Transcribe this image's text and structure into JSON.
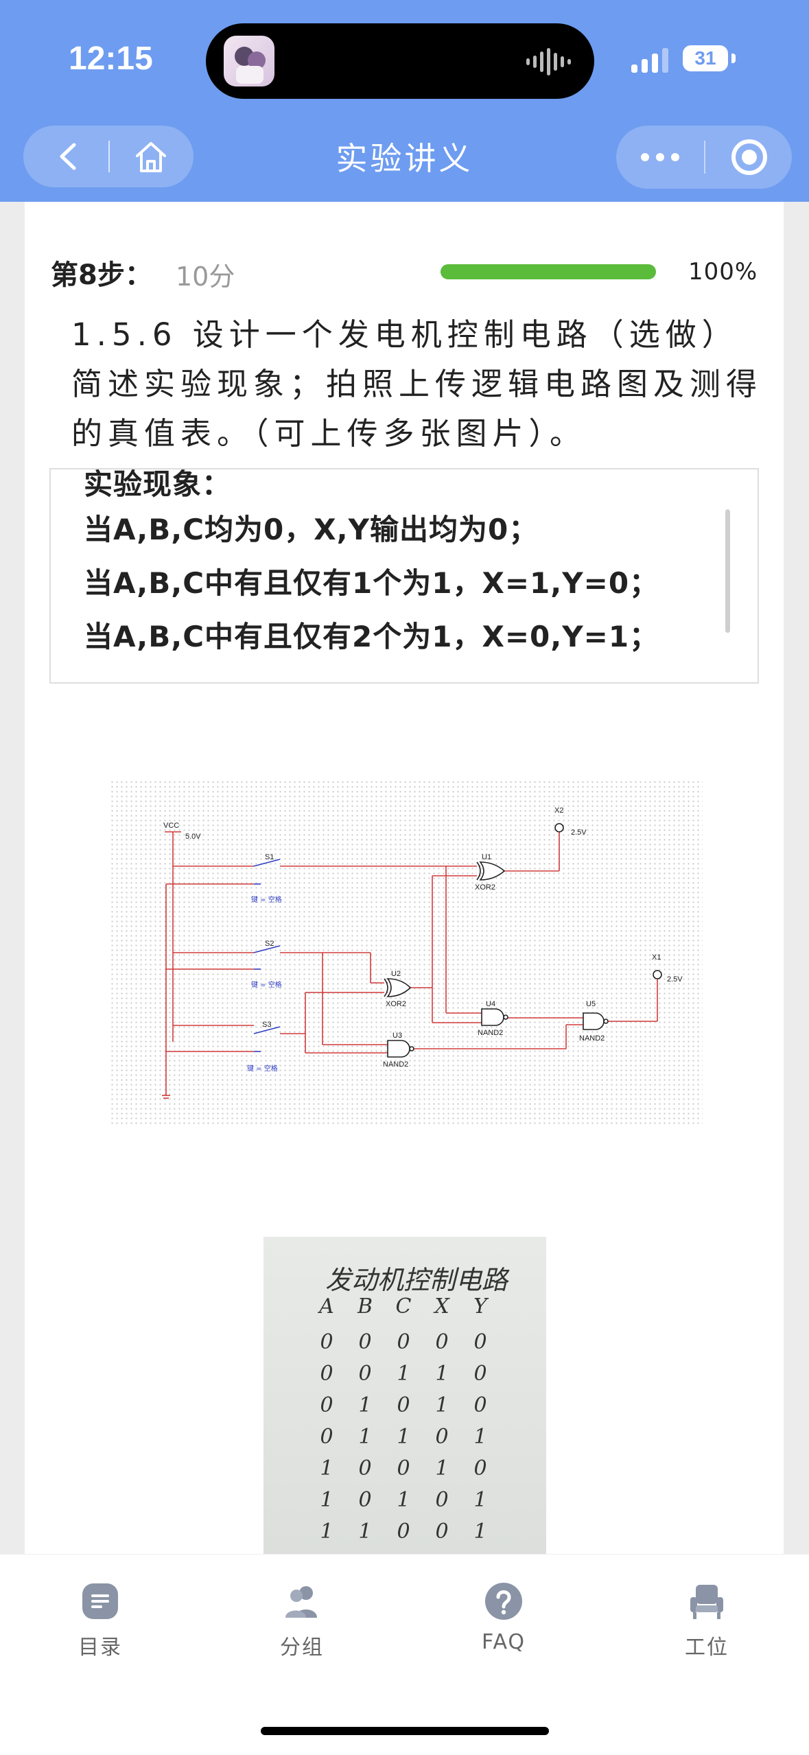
{
  "status_bar": {
    "time": "12:15",
    "battery": "31"
  },
  "nav": {
    "title": "实验讲义"
  },
  "step": {
    "label": "第8步：",
    "score": "10分",
    "progress_text": "100%",
    "progress": 1.0
  },
  "question": {
    "text": "1.5.6 设计一个发电机控制电路（选做）简述实验现象；拍照上传逻辑电路图及测得的真值表。（可上传多张图片）。"
  },
  "answer": {
    "lines": [
      "实验现象：",
      "当A,B,C均为0，X,Y输出均为0；",
      "当A,B,C中有且仅有1个为1，X=1,Y=0；",
      "当A,B,C中有且仅有2个为1，X=0,Y=1；"
    ]
  },
  "circuit": {
    "labels": {
      "vcc": "VCC",
      "vcc_v": "5.0V",
      "s1": "S1",
      "s2": "S2",
      "s3": "S3",
      "key1": "键 = 空格",
      "key2": "键 = 空格",
      "key3": "键 = 空格",
      "u1": "U1",
      "u1_type": "XOR2",
      "u2": "U2",
      "u2_type": "XOR2",
      "u3": "U3",
      "u3_type": "NAND2",
      "u4": "U4",
      "u4_type": "NAND2",
      "u5": "U5",
      "u5_type": "NAND2",
      "x1": "X1",
      "x1_v": "2.5V",
      "x2": "X2",
      "x2_v": "2.5V"
    }
  },
  "photo": {
    "title": "发动机控制电路",
    "header": [
      "A",
      "B",
      "C",
      "X",
      "Y"
    ],
    "rows": [
      [
        "0",
        "0",
        "0",
        "0",
        "0"
      ],
      [
        "0",
        "0",
        "1",
        "1",
        "0"
      ],
      [
        "0",
        "1",
        "0",
        "1",
        "0"
      ],
      [
        "0",
        "1",
        "1",
        "0",
        "1"
      ],
      [
        "1",
        "0",
        "0",
        "1",
        "0"
      ],
      [
        "1",
        "0",
        "1",
        "0",
        "1"
      ],
      [
        "1",
        "1",
        "0",
        "0",
        "1"
      ]
    ]
  },
  "tabbar": {
    "items": [
      {
        "label": "目录",
        "icon": "catalog-icon"
      },
      {
        "label": "分组",
        "icon": "group-icon"
      },
      {
        "label": "FAQ",
        "icon": "question-icon"
      },
      {
        "label": "工位",
        "icon": "seat-icon"
      }
    ]
  },
  "colors": {
    "header": "#6e9cf0",
    "progress": "#5bbb3b",
    "tab_icon": "#8a94a6",
    "wire": "#d23a3a",
    "switch": "#2f3fc4"
  }
}
